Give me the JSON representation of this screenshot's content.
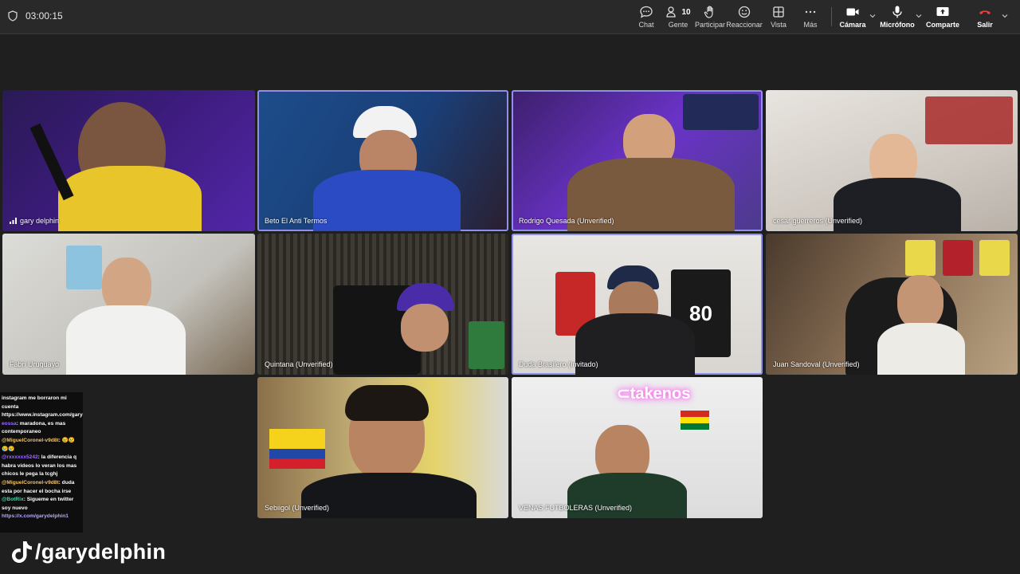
{
  "meeting": {
    "timer": "03:00:15"
  },
  "toolbar": {
    "chat": "Chat",
    "people": "Gente",
    "people_count": "10",
    "raise": "Participar",
    "react": "Reaccionar",
    "view": "Vista",
    "more": "Más",
    "camera": "Cámara",
    "mic": "Micrófono",
    "share": "Comparte",
    "leave": "Salir"
  },
  "participants": [
    {
      "name": "gary delphin"
    },
    {
      "name": "Beto El Anti Termos"
    },
    {
      "name": "Rodrigo Quesada (Unverified)"
    },
    {
      "name": "cesar guerreros (Unverified)"
    },
    {
      "name": "Fabri Uruguayo"
    },
    {
      "name": "Quintana (Unverified)"
    },
    {
      "name": "Duda Brasilero (Invitado)"
    },
    {
      "name": "Juan Sandoval (Unverified)"
    },
    {
      "name": "Sebiigol (Unverified)"
    },
    {
      "name": "VENAS FUTBOLERAS (Unverified)"
    }
  ],
  "chat_overlay": {
    "lines": [
      {
        "user": "",
        "text": "instagram me borraron mi cuenta https://www.instagram.com/garydelphinfutbol",
        "user_color": "#ffffff"
      },
      {
        "user": "eossa",
        "text": ": maradona, es mas contemporaneo",
        "user_color": "#9a6bff"
      },
      {
        "user": "@MiguelCoronel-v9d8t",
        "text": ": 😢😢😢😢",
        "user_color": "#f0c36b"
      },
      {
        "user": "@rxxxxxx5242",
        "text": ": la diferencia q habra videos lo veran los mas chicos le pega la tcghj",
        "user_color": "#9a6bff"
      },
      {
        "user": "@MiguelCoronel-v9d8t",
        "text": ": duda esta por hacer el bocha irse",
        "user_color": "#f0c36b"
      },
      {
        "user": "@BotRix",
        "text": ": Sigueme en twitter soy nuevo",
        "user_color": "#47d4a8"
      },
      {
        "user": "",
        "text": "https://x.com/garydelphin1",
        "user_color": "#b9a6ff"
      }
    ]
  },
  "watermark": {
    "handle": "/garydelphin"
  }
}
